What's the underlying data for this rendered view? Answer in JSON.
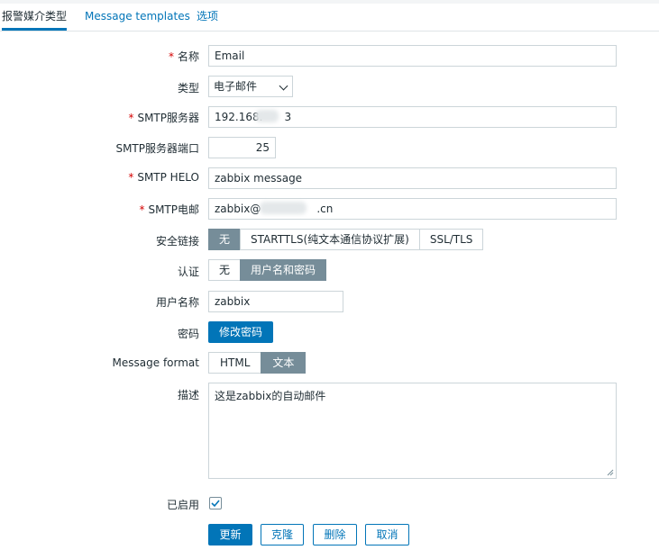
{
  "tabs": [
    {
      "label": "报警媒介类型",
      "active": true
    },
    {
      "label": "Message templates",
      "active": false
    },
    {
      "label": "选项",
      "active": false
    }
  ],
  "form": {
    "name": {
      "label": "名称",
      "required": true,
      "value": "Email"
    },
    "type": {
      "label": "类型",
      "value": "电子邮件"
    },
    "smtp_server": {
      "label": "SMTP服务器",
      "required": true,
      "value_start": "192.168.",
      "value_end": "3"
    },
    "smtp_port": {
      "label": "SMTP服务器端口",
      "value": "25"
    },
    "smtp_helo": {
      "label": "SMTP HELO",
      "required": true,
      "value": "zabbix message"
    },
    "smtp_email": {
      "label": "SMTP电邮",
      "required": true,
      "value_start": "zabbix@",
      "value_end": ".cn"
    },
    "security": {
      "label": "安全链接",
      "options": [
        "无",
        "STARTTLS(纯文本通信协议扩展)",
        "SSL/TLS"
      ],
      "selected": 0
    },
    "auth": {
      "label": "认证",
      "options": [
        "无",
        "用户名和密码"
      ],
      "selected": 1
    },
    "username": {
      "label": "用户名称",
      "value": "zabbix"
    },
    "password": {
      "label": "密码",
      "button": "修改密码"
    },
    "message_format": {
      "label": "Message format",
      "options": [
        "HTML",
        "文本"
      ],
      "selected": 1
    },
    "description": {
      "label": "描述",
      "value": "这是zabbix的自动邮件"
    },
    "enabled": {
      "label": "已启用",
      "checked": true
    }
  },
  "actions": {
    "update": "更新",
    "clone": "克隆",
    "delete": "删除",
    "cancel": "取消"
  },
  "colors": {
    "accent": "#0275b8",
    "segment_active": "#768d99",
    "required": "#d40000"
  }
}
